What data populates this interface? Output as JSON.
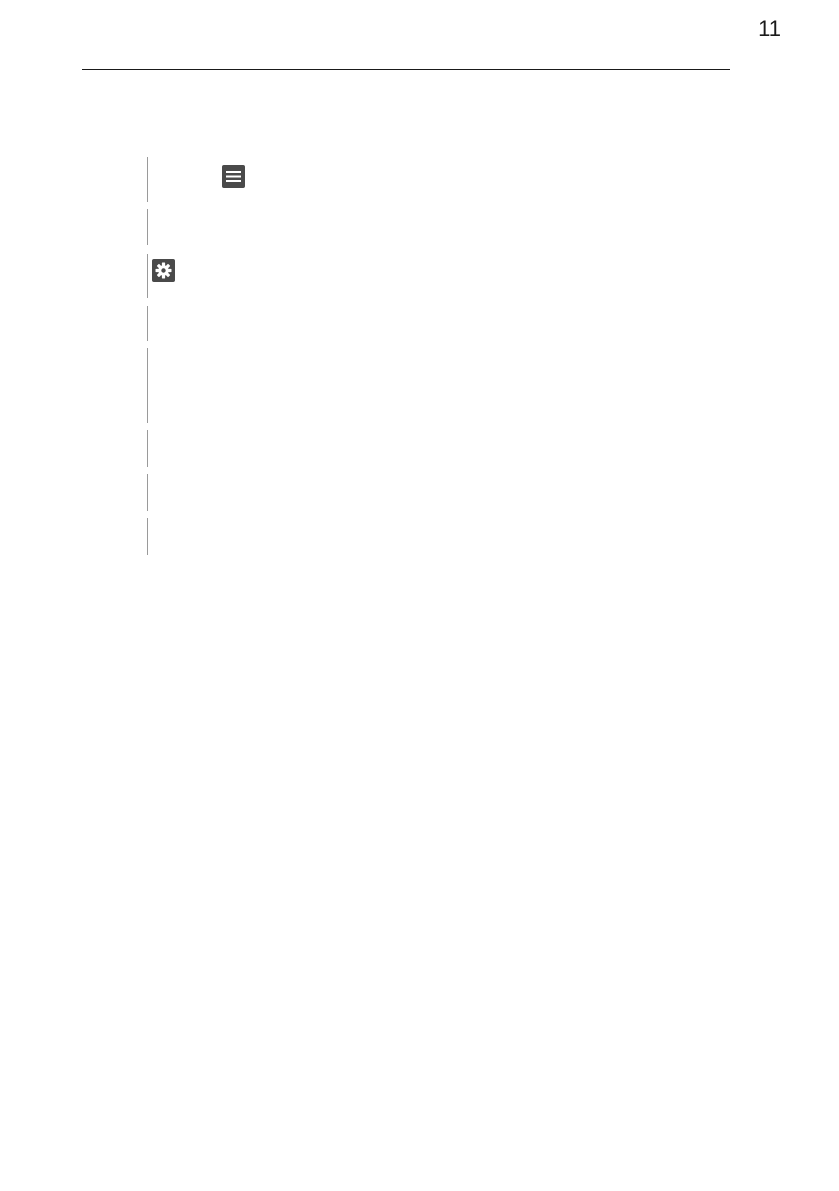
{
  "page": {
    "page_number": "11"
  },
  "icons": {
    "menu": "hamburger-menu-icon",
    "settings": "gear-icon"
  },
  "colors": {
    "icon_fill": "#4a4a4a",
    "bar_color": "#9a9a9a",
    "rule_color": "#1a1a1a"
  }
}
